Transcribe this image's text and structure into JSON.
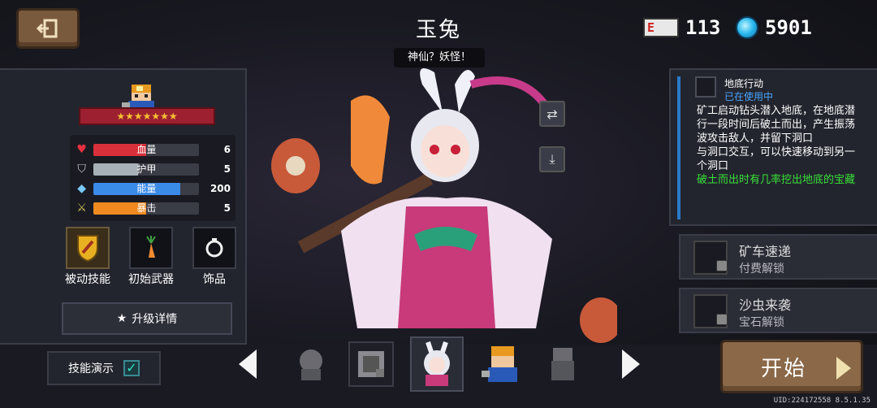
{
  "header": {
    "title": "玉兔",
    "subtitle": "神仙？妖怪！",
    "tickets": "113",
    "ticket_icon_text": "E",
    "gems": "5901"
  },
  "stats": [
    {
      "label": "血量",
      "value": "6",
      "fill": 0.5,
      "color": "#d8303a",
      "icon": "heart-icon"
    },
    {
      "label": "护甲",
      "value": "5",
      "fill": 0.42,
      "color": "#a8b0b8",
      "icon": "shield-icon"
    },
    {
      "label": "能量",
      "value": "200",
      "fill": 0.82,
      "color": "#3a8ae8",
      "icon": "energy-icon"
    },
    {
      "label": "暴击",
      "value": "5",
      "fill": 0.5,
      "color": "#f08a20",
      "icon": "crit-icon"
    }
  ],
  "rarity_stars": "★★★★★★★",
  "slots": {
    "passive": "被动技能",
    "weapon": "初始武器",
    "accessory": "饰品"
  },
  "upgrade_label": "升级详情",
  "skill": {
    "name": "地底行动",
    "status": "已在使用中",
    "description": "矿工启动钻头潜入地底，在地底潜行一段时间后破土而出，产生振荡波攻击敌人，并留下洞口\n与洞口交互，可以快速移动到另一个洞口",
    "extra": "破土而出时有几率挖出地底的宝藏"
  },
  "skins": [
    {
      "title": "矿车速递",
      "unlock": "付费解锁"
    },
    {
      "title": "沙虫来袭",
      "unlock": "宝石解锁"
    }
  ],
  "demo_label": "技能演示",
  "demo_checked": "✓",
  "start_label": "开始",
  "uid": "UID:224172558 8.5.1.35",
  "colors": {
    "brand_brown": "#8a6848",
    "accent_blue": "#2a7ac8",
    "extra_green": "#38e038",
    "ribbon_red": "#9c2030"
  }
}
